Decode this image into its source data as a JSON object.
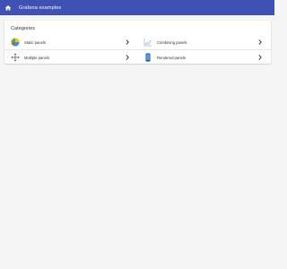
{
  "appbar": {
    "title": "Grafana examples",
    "home_icon": "home-icon"
  },
  "categories": {
    "title": "Categories",
    "items": [
      {
        "label": "Static panels",
        "icon": "pie-chart-icon"
      },
      {
        "label": "Combining panels",
        "icon": "line-chart-icon"
      },
      {
        "label": "Multiple panels",
        "icon": "move-arrows-icon"
      },
      {
        "label": "Rendered panels",
        "icon": "tablet-device-icon"
      }
    ]
  },
  "colors": {
    "appbar": "#3f51b5",
    "background": "#f5f5f5"
  }
}
